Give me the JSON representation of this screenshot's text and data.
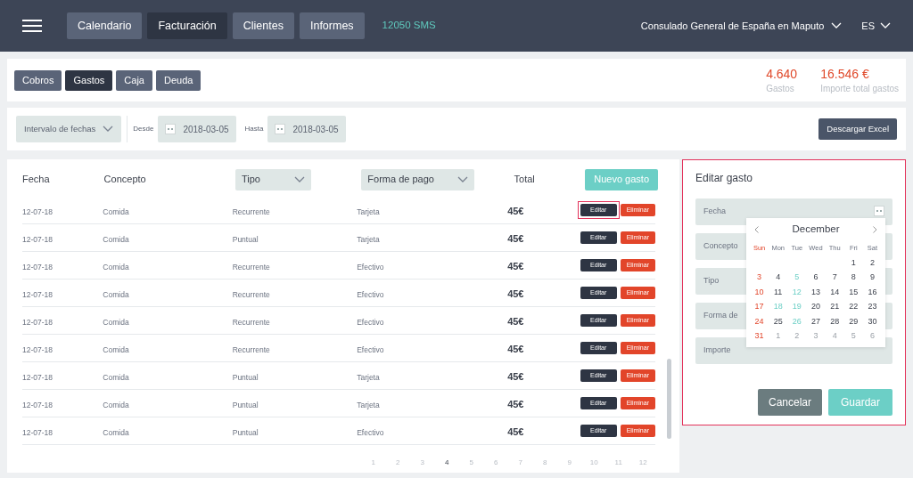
{
  "nav": {
    "tabs": [
      {
        "label": "Calendario",
        "selected": false
      },
      {
        "label": "Facturación",
        "selected": true
      },
      {
        "label": "Clientes",
        "selected": false
      },
      {
        "label": "Informes",
        "selected": false
      }
    ],
    "sms": "12050 SMS",
    "office": "Consulado General de España en Maputo",
    "language": "ES"
  },
  "subtabs": [
    {
      "label": "Cobros",
      "selected": false
    },
    {
      "label": "Gastos",
      "selected": true
    },
    {
      "label": "Caja",
      "selected": false
    },
    {
      "label": "Deuda",
      "selected": false
    }
  ],
  "stats": [
    {
      "value": "4.640",
      "label": "Gastos"
    },
    {
      "value": "16.546 €",
      "label": "Importe total gastos"
    }
  ],
  "filters": {
    "interval": "Intervalo de fechas",
    "from_label": "Desde",
    "from": "2018-03-05",
    "to_label": "Hasta",
    "to": "2018-03-05",
    "export": "Descargar Excel"
  },
  "table": {
    "columns": [
      {
        "label": "Fecha",
        "kind": "text"
      },
      {
        "label": "Concepto",
        "kind": "text"
      },
      {
        "label": "Tipo",
        "kind": "dropdown"
      },
      {
        "label": "Forma de pago",
        "kind": "dropdown"
      },
      {
        "label": "Total",
        "kind": "text"
      }
    ],
    "new_button": "Nuevo gasto",
    "rows": [
      {
        "cells": [
          "12-07-18",
          "Comida",
          "Recurrente",
          "Tarjeta",
          "45€"
        ],
        "edit": "Editar",
        "delete": "Eliminar",
        "highlighted": true
      },
      {
        "cells": [
          "12-07-18",
          "Comida",
          "Puntual",
          "Tarjeta",
          "45€"
        ],
        "edit": "Editar",
        "delete": "Eliminar",
        "highlighted": false
      },
      {
        "cells": [
          "12-07-18",
          "Comida",
          "Recurrente",
          "Efectivo",
          "45€"
        ],
        "edit": "Editar",
        "delete": "Eliminar",
        "highlighted": false
      },
      {
        "cells": [
          "12-07-18",
          "Comida",
          "Recurrente",
          "Efectivo",
          "45€"
        ],
        "edit": "Editar",
        "delete": "Eliminar",
        "highlighted": false
      },
      {
        "cells": [
          "12-07-18",
          "Comida",
          "Recurrente",
          "Efectivo",
          "45€"
        ],
        "edit": "Editar",
        "delete": "Eliminar",
        "highlighted": false
      },
      {
        "cells": [
          "12-07-18",
          "Comida",
          "Recurrente",
          "Efectivo",
          "45€"
        ],
        "edit": "Editar",
        "delete": "Eliminar",
        "highlighted": false
      },
      {
        "cells": [
          "12-07-18",
          "Comida",
          "Puntual",
          "Tarjeta",
          "45€"
        ],
        "edit": "Editar",
        "delete": "Eliminar",
        "highlighted": false
      },
      {
        "cells": [
          "12-07-18",
          "Comida",
          "Puntual",
          "Tarjeta",
          "45€"
        ],
        "edit": "Editar",
        "delete": "Eliminar",
        "highlighted": false
      },
      {
        "cells": [
          "12-07-18",
          "Comida",
          "Puntual",
          "Efectivo",
          "45€"
        ],
        "edit": "Editar",
        "delete": "Eliminar",
        "highlighted": false
      }
    ],
    "pages": [
      {
        "label": "1",
        "selected": false
      },
      {
        "label": "2",
        "selected": false
      },
      {
        "label": "3",
        "selected": false
      },
      {
        "label": "4",
        "selected": true
      },
      {
        "label": "5",
        "selected": false
      },
      {
        "label": "6",
        "selected": false
      },
      {
        "label": "7",
        "selected": false
      },
      {
        "label": "8",
        "selected": false
      },
      {
        "label": "9",
        "selected": false
      },
      {
        "label": "10",
        "selected": false
      },
      {
        "label": "11",
        "selected": false
      },
      {
        "label": "12",
        "selected": false
      }
    ]
  },
  "edit_panel": {
    "title": "Editar gasto",
    "highlighted": true,
    "fields": [
      "Fecha",
      "Concepto",
      "Tipo",
      "Forma de",
      "Importe"
    ],
    "calendar": {
      "month": "December",
      "weekdays": [
        "Sun",
        "Mon",
        "Tue",
        "Wed",
        "Thu",
        "Fri",
        "Sat"
      ],
      "weeks": [
        [
          {
            "day": "1",
            "kind": "normal"
          },
          {
            "day": "2",
            "kind": "normal"
          }
        ],
        [
          {
            "day": "3",
            "kind": "sunday"
          },
          {
            "day": "4",
            "kind": "normal"
          },
          {
            "day": "5",
            "kind": "marked"
          },
          {
            "day": "6",
            "kind": "normal"
          },
          {
            "day": "7",
            "kind": "normal"
          },
          {
            "day": "8",
            "kind": "normal"
          },
          {
            "day": "9",
            "kind": "normal"
          }
        ],
        [
          {
            "day": "10",
            "kind": "sunday"
          },
          {
            "day": "11",
            "kind": "normal"
          },
          {
            "day": "12",
            "kind": "marked"
          },
          {
            "day": "13",
            "kind": "normal"
          },
          {
            "day": "14",
            "kind": "normal"
          },
          {
            "day": "15",
            "kind": "normal"
          },
          {
            "day": "16",
            "kind": "normal"
          }
        ],
        [
          {
            "day": "17",
            "kind": "sunday"
          },
          {
            "day": "18",
            "kind": "marked"
          },
          {
            "day": "19",
            "kind": "marked"
          },
          {
            "day": "20",
            "kind": "normal"
          },
          {
            "day": "21",
            "kind": "normal"
          },
          {
            "day": "22",
            "kind": "normal"
          },
          {
            "day": "23",
            "kind": "normal"
          }
        ],
        [
          {
            "day": "24",
            "kind": "sunday"
          },
          {
            "day": "25",
            "kind": "normal"
          },
          {
            "day": "26",
            "kind": "marked"
          },
          {
            "day": "27",
            "kind": "normal"
          },
          {
            "day": "28",
            "kind": "normal"
          },
          {
            "day": "29",
            "kind": "normal"
          },
          {
            "day": "30",
            "kind": "normal"
          }
        ],
        [
          {
            "day": "31",
            "kind": "sunday"
          },
          {
            "day": "1",
            "kind": "other"
          },
          {
            "day": "2",
            "kind": "other"
          },
          {
            "day": "3",
            "kind": "other"
          },
          {
            "day": "4",
            "kind": "other"
          },
          {
            "day": "5",
            "kind": "other"
          },
          {
            "day": "6",
            "kind": "other"
          }
        ]
      ]
    },
    "cancel": "Cancelar",
    "save": "Guardar"
  }
}
